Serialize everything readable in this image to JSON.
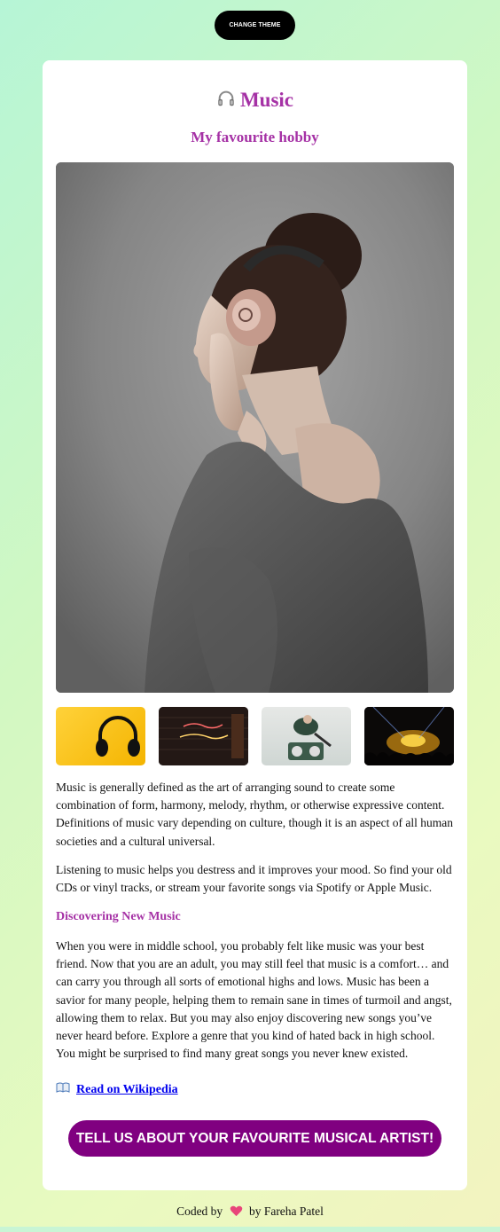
{
  "header": {
    "theme_button_label": "CHANGE THEME"
  },
  "card": {
    "title": "Music",
    "title_icon": "headphones-icon",
    "subtitle": "My favourite hobby",
    "hero_image": "woman-with-headphones-photo",
    "thumbnails": [
      {
        "name": "yellow-headphones-photo"
      },
      {
        "name": "neon-sign-photo"
      },
      {
        "name": "boombox-photo"
      },
      {
        "name": "concert-crowd-photo"
      }
    ],
    "paragraph_1": "Music is generally defined as the art of arranging sound to create some combination of form, harmony, melody, rhythm, or otherwise expressive content. Definitions of music vary depending on culture, though it is an aspect of all human societies and a cultural universal.",
    "paragraph_2": "Listening to music helps you destress and it improves your mood. So find your old CDs or vinyl tracks, or stream your favorite songs via Spotify or Apple Music.",
    "section_heading": "Discovering New Music",
    "paragraph_3": "When you were in middle school, you probably felt like music was your best friend. Now that you are an adult, you may still feel that music is a comfort… and can carry you through all sorts of emotional highs and lows. Music has been a savior for many people, helping them to remain sane in times of turmoil and angst, allowing them to relax. But you may also enjoy discovering new songs you’ve never heard before. Explore a genre that you kind of hated back in high school. You might be surprised to find many great songs you never knew existed.",
    "wiki_link_label": "Read on Wikipedia",
    "wiki_icon": "open-book-icon",
    "cta_label": "TELL US ABOUT YOUR FAVOURITE MUSICAL ARTIST!"
  },
  "footer": {
    "prefix": "Coded by",
    "heart_icon": "heart-icon",
    "suffix": "by Fareha Patel"
  },
  "colors": {
    "accent": "#a531a5",
    "cta": "#800080",
    "link": "#0000ee"
  }
}
